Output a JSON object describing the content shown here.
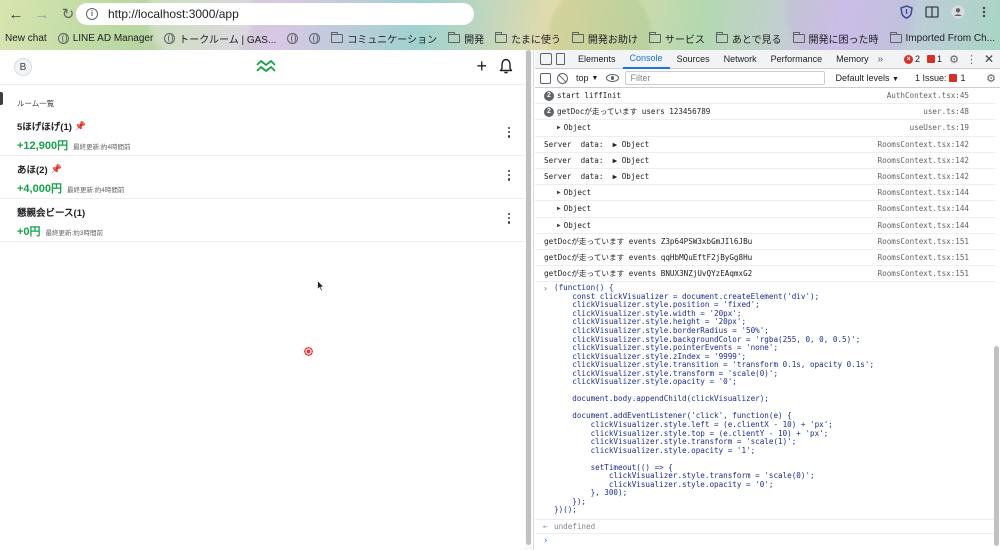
{
  "browser": {
    "url": "http://localhost:3000/app",
    "bookmarks": [
      {
        "label": "New chat",
        "icon": "none"
      },
      {
        "label": "LINE AD Manager",
        "icon": "globe-icon"
      },
      {
        "label": "トークルーム | GAS...",
        "icon": "globe-icon"
      },
      {
        "label": "",
        "icon": "globe-icon"
      },
      {
        "label": "",
        "icon": "globe-icon"
      },
      {
        "label": "コミュニケーション",
        "icon": "folder-icon"
      },
      {
        "label": "開発",
        "icon": "folder-icon"
      },
      {
        "label": "たまに使う",
        "icon": "folder-icon"
      },
      {
        "label": "開発お助け",
        "icon": "folder-icon"
      },
      {
        "label": "サービス",
        "icon": "folder-icon"
      },
      {
        "label": "あとで見る",
        "icon": "folder-icon"
      },
      {
        "label": "開発に困った時",
        "icon": "folder-icon"
      },
      {
        "label": "Imported From Ch...",
        "icon": "folder-icon"
      }
    ]
  },
  "app": {
    "avatar_letter": "B",
    "section_label": "ルーム一覧",
    "rooms": [
      {
        "name": "5ほげほげ(1)",
        "pinned": true,
        "amount": "+12,900円",
        "meta": "最終更新:約4時間前"
      },
      {
        "name": "あほ(2)",
        "pinned": true,
        "amount": "+4,000円",
        "meta": "最終更新:約4時間前"
      },
      {
        "name": "懇親会ビース(1)",
        "pinned": false,
        "amount": "+0円",
        "meta": "最終更新:約3時間前"
      }
    ],
    "accent_green": "#16a34a",
    "pin_color": "#1a56d6"
  },
  "devtools": {
    "tabs": [
      "Elements",
      "Console",
      "Sources",
      "Network",
      "Performance",
      "Memory"
    ],
    "active_tab": "Console",
    "error_count": "2",
    "warning_count": "1",
    "context": "top",
    "filter_placeholder": "Filter",
    "levels": "Default levels",
    "issues": "1 Issue:",
    "issues_count": "1",
    "logs": [
      {
        "count": "2",
        "text": "start liffInit",
        "source": "AuthContext.tsx:45",
        "type": "count"
      },
      {
        "count": "2",
        "text": "getDocが走っています users 123456789",
        "source": "user.ts:48",
        "type": "count"
      },
      {
        "text": "Object",
        "source": "useUser.ts:19",
        "type": "object"
      },
      {
        "text": "Server  data:  ▶ Object",
        "source": "RoomsContext.tsx:142",
        "type": "plain"
      },
      {
        "text": "Server  data:  ▶ Object",
        "source": "RoomsContext.tsx:142",
        "type": "plain"
      },
      {
        "text": "Server  data:  ▶ Object",
        "source": "RoomsContext.tsx:142",
        "type": "plain"
      },
      {
        "text": "Object",
        "source": "RoomsContext.tsx:144",
        "type": "object"
      },
      {
        "text": "Object",
        "source": "RoomsContext.tsx:144",
        "type": "object"
      },
      {
        "text": "Object",
        "source": "RoomsContext.tsx:144",
        "type": "object"
      },
      {
        "text": "getDocが走っています events Z3p64PSW3xbGmJIl6JBu",
        "source": "RoomsContext.tsx:151",
        "type": "plain"
      },
      {
        "text": "getDocが走っています events qqHbMQuEftF2jByGg8Hu",
        "source": "RoomsContext.tsx:151",
        "type": "plain"
      },
      {
        "text": "getDocが走っています events BNUX3NZjUvQYzEAqmxG2",
        "source": "RoomsContext.tsx:151",
        "type": "plain"
      }
    ],
    "code_lines": [
      "(function() {",
      "    const clickVisualizer = document.createElement('div');",
      "    clickVisualizer.style.position = 'fixed';",
      "    clickVisualizer.style.width = '20px';",
      "    clickVisualizer.style.height = '20px';",
      "    clickVisualizer.style.borderRadius = '50%';",
      "    clickVisualizer.style.backgroundColor = 'rgba(255, 0, 0, 0.5)';",
      "    clickVisualizer.style.pointerEvents = 'none';",
      "    clickVisualizer.style.zIndex = '9999';",
      "    clickVisualizer.style.transition = 'transform 0.1s, opacity 0.1s';",
      "    clickVisualizer.style.transform = 'scale(0)';",
      "    clickVisualizer.style.opacity = '0';",
      "",
      "    document.body.appendChild(clickVisualizer);",
      "",
      "    document.addEventListener('click', function(e) {",
      "        clickVisualizer.style.left = (e.clientX - 10) + 'px';",
      "        clickVisualizer.style.top = (e.clientY - 10) + 'px';",
      "        clickVisualizer.style.transform = 'scale(1)';",
      "        clickVisualizer.style.opacity = '1';",
      "",
      "        setTimeout(() => {",
      "            clickVisualizer.style.transform = 'scale(0)';",
      "            clickVisualizer.style.opacity = '0';",
      "        }, 300);",
      "    });",
      "})();"
    ],
    "result": "undefined"
  }
}
